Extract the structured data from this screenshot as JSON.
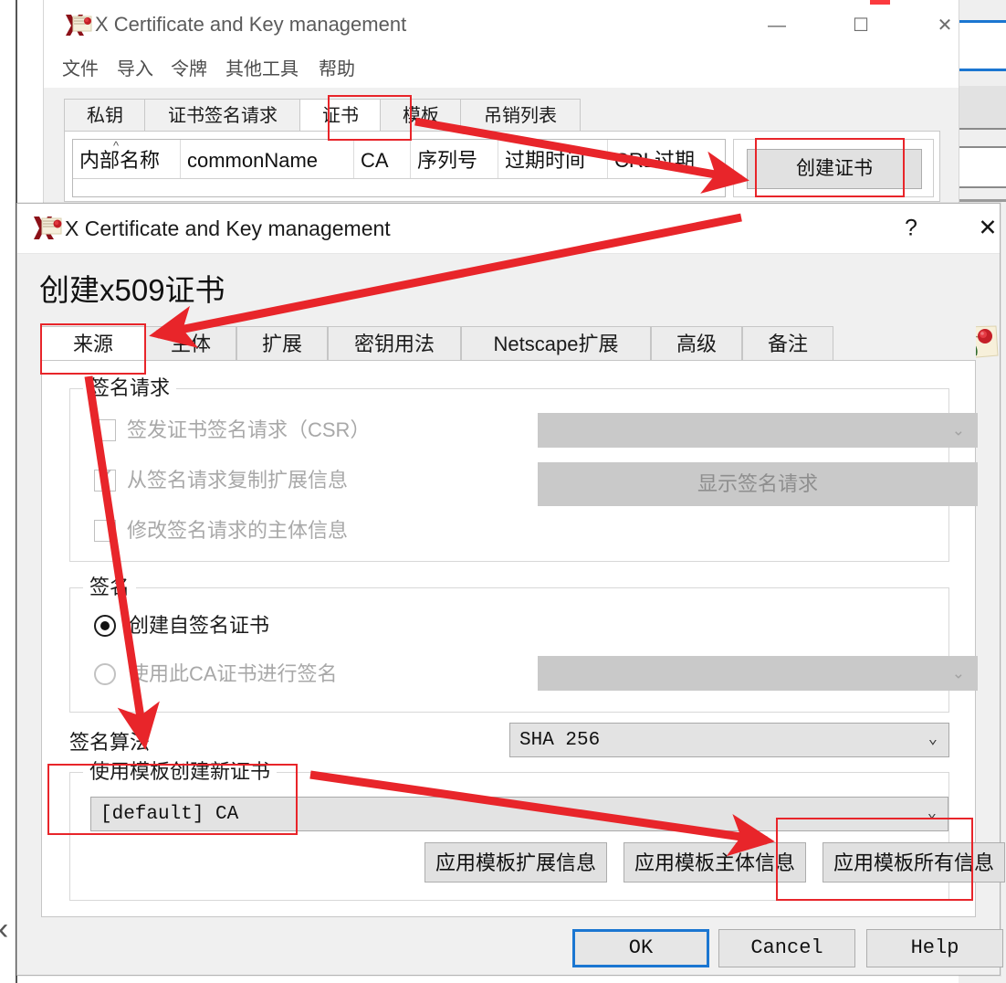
{
  "main_window": {
    "title": "X Certificate and Key management",
    "icon": "xca-scroll-icon",
    "controls": {
      "minimize": "—",
      "maximize": "☐",
      "close": "✕"
    },
    "menu": [
      "文件",
      "导入",
      "令牌",
      "其他工具",
      "帮助"
    ],
    "tabs": [
      {
        "label": "私钥",
        "selected": false
      },
      {
        "label": "证书签名请求",
        "selected": false
      },
      {
        "label": "证书",
        "selected": true
      },
      {
        "label": "模板",
        "selected": false
      },
      {
        "label": "吊销列表",
        "selected": false
      }
    ],
    "table_columns": [
      "内部名称",
      "commonName",
      "CA",
      "序列号",
      "过期时间",
      "CRL过期"
    ],
    "sort_caret": "^",
    "side_buttons": [
      "创建证书"
    ]
  },
  "dialog": {
    "title": "X Certificate and Key management",
    "icon": "xca-scroll-icon",
    "help_glyph": "?",
    "close_glyph": "✕",
    "heading": "创建x509证书",
    "logo": "xca-certificate-scroll-logo",
    "tabs": [
      {
        "label": "来源",
        "selected": true
      },
      {
        "label": "主体",
        "selected": false
      },
      {
        "label": "扩展",
        "selected": false
      },
      {
        "label": "密钥用法",
        "selected": false
      },
      {
        "label": "Netscape扩展",
        "selected": false
      },
      {
        "label": "高级",
        "selected": false
      },
      {
        "label": "备注",
        "selected": false
      }
    ],
    "signing_request_group": {
      "title": "签名请求",
      "checkboxes": [
        {
          "label": "签发证书签名请求（CSR）",
          "checked": false,
          "enabled": false
        },
        {
          "label": "从签名请求复制扩展信息",
          "checked": true,
          "enabled": false
        },
        {
          "label": "修改签名请求的主体信息",
          "checked": false,
          "enabled": false
        }
      ],
      "csr_combo": {
        "value": "",
        "enabled": false,
        "arrow": "⌄"
      },
      "show_request_button": {
        "label": "显示签名请求",
        "enabled": false
      }
    },
    "signature_group": {
      "title": "签名",
      "radios": [
        {
          "label": "创建自签名证书",
          "selected": true,
          "enabled": true
        },
        {
          "label": "使用此CA证书进行签名",
          "selected": false,
          "enabled": false
        }
      ],
      "ca_combo": {
        "value": "",
        "enabled": false,
        "arrow": "⌄"
      }
    },
    "signature_algorithm": {
      "label": "签名算法",
      "value": "SHA 256",
      "arrow": "⌄"
    },
    "template_group": {
      "title": "使用模板创建新证书",
      "combo": {
        "value": "[default] CA",
        "arrow": "⌄"
      },
      "buttons": [
        "应用模板扩展信息",
        "应用模板主体信息",
        "应用模板所有信息"
      ]
    },
    "footer_buttons": [
      {
        "label": "OK",
        "default": true
      },
      {
        "label": "Cancel",
        "default": false
      },
      {
        "label": "Help",
        "default": false
      }
    ]
  },
  "annotations": {
    "accent_color": "#e8252a",
    "highlight_boxes": [
      "证书-tab-highlight",
      "创建证书-button-highlight",
      "来源-tab-highlight",
      "使用模板创建新证书-highlight",
      "应用模板所有信息-highlight"
    ],
    "arrows": [
      "证书-tab-to-创建证书-button",
      "创建证书-button-to-来源-tab",
      "来源-tab-to-使用模板创建新证书",
      "使用模板创建新证书-to-应用模板所有信息"
    ]
  },
  "backdrop": {
    "chevron": "‹"
  }
}
